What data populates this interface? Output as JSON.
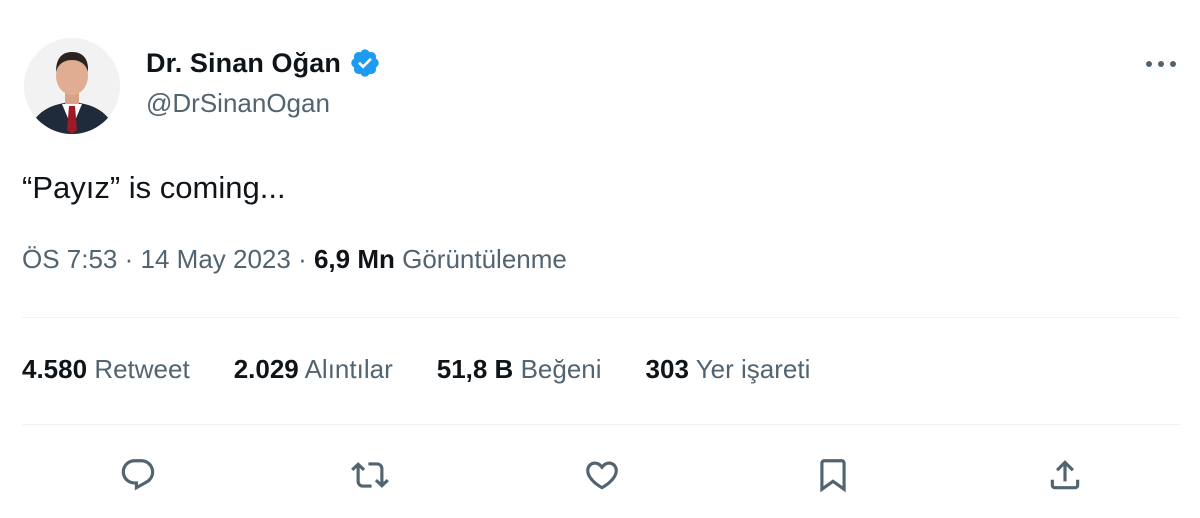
{
  "author": {
    "display_name": "Dr. Sinan Oğan",
    "handle": "@DrSinanOgan",
    "verified_icon": "verified-badge-icon",
    "avatar": "avatar",
    "verified_color": "#1d9bf0"
  },
  "tweet": {
    "text": "“Payız” is coming...",
    "time": "ÖS 7:53",
    "separator": " · ",
    "date": "14 May 2023",
    "views_count": "6,9 Mn",
    "views_label": "Görüntülenme"
  },
  "stats": [
    {
      "count": "4.580",
      "label": "Retweet"
    },
    {
      "count": "2.029",
      "label": "Alıntılar"
    },
    {
      "count": "51,8 B",
      "label": "Beğeni"
    },
    {
      "count": "303",
      "label": "Yer işareti"
    }
  ],
  "actions": [
    {
      "name": "reply",
      "icon": "reply-icon"
    },
    {
      "name": "retweet",
      "icon": "retweet-icon"
    },
    {
      "name": "like",
      "icon": "heart-icon"
    },
    {
      "name": "bookmark",
      "icon": "bookmark-icon"
    },
    {
      "name": "share",
      "icon": "share-icon"
    }
  ],
  "more_icon": "more-icon",
  "colors": {
    "text_primary": "#0f1419",
    "text_secondary": "#536471",
    "divider": "#eff3f4",
    "icon": "#536471"
  }
}
